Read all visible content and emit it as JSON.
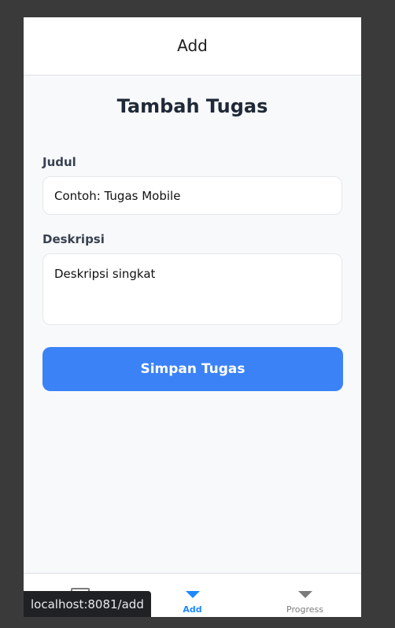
{
  "header": {
    "title": "Add"
  },
  "form": {
    "title": "Tambah Tugas",
    "judul_label": "Judul",
    "judul_placeholder": "Contoh: Tugas Mobile",
    "deskripsi_label": "Deskripsi",
    "deskripsi_placeholder": "Deskripsi singkat",
    "submit_label": "Simpan Tugas"
  },
  "tabbar": {
    "tabs": [
      {
        "label": "",
        "icon": "home-icon"
      },
      {
        "label": "Add",
        "icon": "triangle-down-icon",
        "active": true
      },
      {
        "label": "Progress",
        "icon": "triangle-down-icon"
      }
    ]
  },
  "status_tooltip": {
    "url": "localhost:8081/add"
  },
  "colors": {
    "accent": "#3b82f6",
    "active_tab": "#1e88ff",
    "inactive_tab": "#7c7c7c",
    "background": "#3a3a3a",
    "page_background": "#f8f9fb"
  }
}
